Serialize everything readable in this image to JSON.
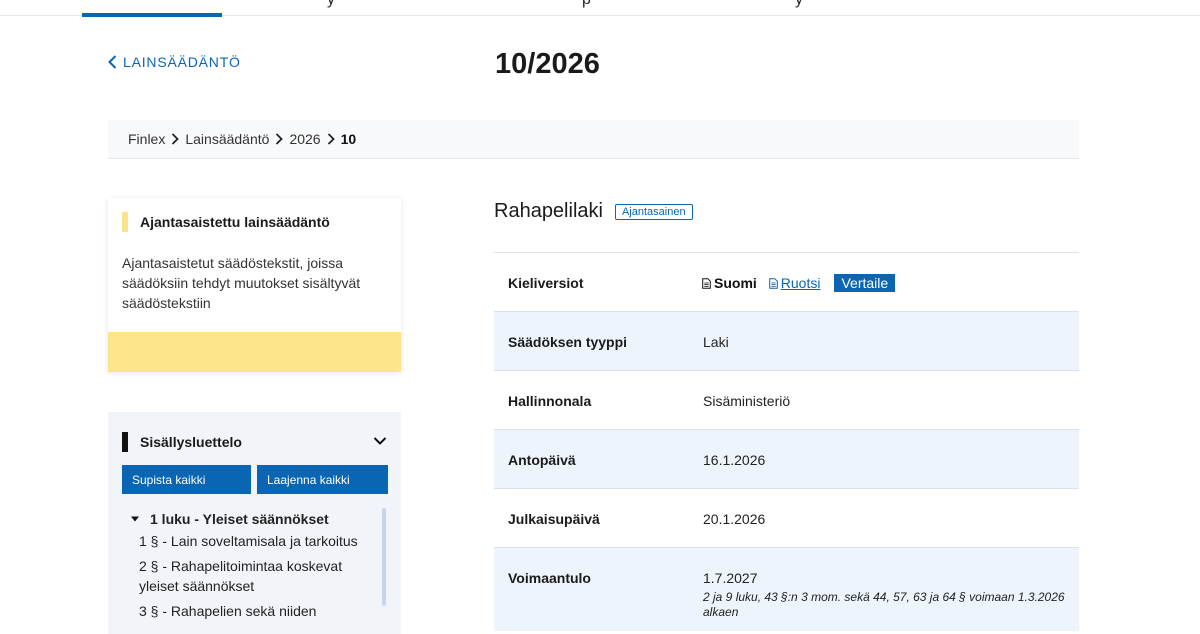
{
  "topbar": {
    "partial_glyphs": [
      "y",
      "p",
      "y"
    ]
  },
  "nav": {
    "back_label": "LAINSÄÄDÄNTÖ"
  },
  "page": {
    "title": "10/2026"
  },
  "breadcrumb": {
    "items": [
      "Finlex",
      "Lainsäädäntö",
      "2026"
    ],
    "current": "10"
  },
  "updated_card": {
    "title": "Ajantasaistettu lainsäädäntö",
    "description": "Ajantasaistetut säädöstekstit, joissa säädöksiin tehdyt muutokset sisältyvät säädöstekstiin"
  },
  "toc": {
    "title": "Sisällysluettelo",
    "collapse_all": "Supista kaikki",
    "expand_all": "Laajenna kaikki",
    "chapter": "1 luku - Yleiset säännökset",
    "items": [
      "1 § - Lain soveltamisala ja tarkoitus",
      "2 § - Rahapelitoimintaa koskevat yleiset säännökset",
      "3 § - Rahapelien sekä niiden"
    ]
  },
  "act": {
    "name": "Rahapelilaki",
    "badge": "Ajantasainen",
    "rows": {
      "language": {
        "label": "Kieliversiot",
        "finnish": "Suomi",
        "swedish": "Ruotsi",
        "compare": "Vertaile"
      },
      "type": {
        "label": "Säädöksen tyyppi",
        "value": "Laki"
      },
      "ministry": {
        "label": "Hallinnonala",
        "value": "Sisäministeriö"
      },
      "issued": {
        "label": "Antopäivä",
        "value": "16.1.2026"
      },
      "published": {
        "label": "Julkaisupäivä",
        "value": "20.1.2026"
      },
      "effective": {
        "label": "Voimaantulo",
        "value": "1.7.2027",
        "note": "2 ja 9 luku, 43 §:n 3 mom. sekä 44, 57, 63 ja 64 § voimaan 1.3.2026 alkaen"
      }
    }
  },
  "colors": {
    "accent": "#0a66b3",
    "highlight": "#fde68a",
    "panel": "#f1f5f9",
    "row_alt": "#eef4fb"
  }
}
